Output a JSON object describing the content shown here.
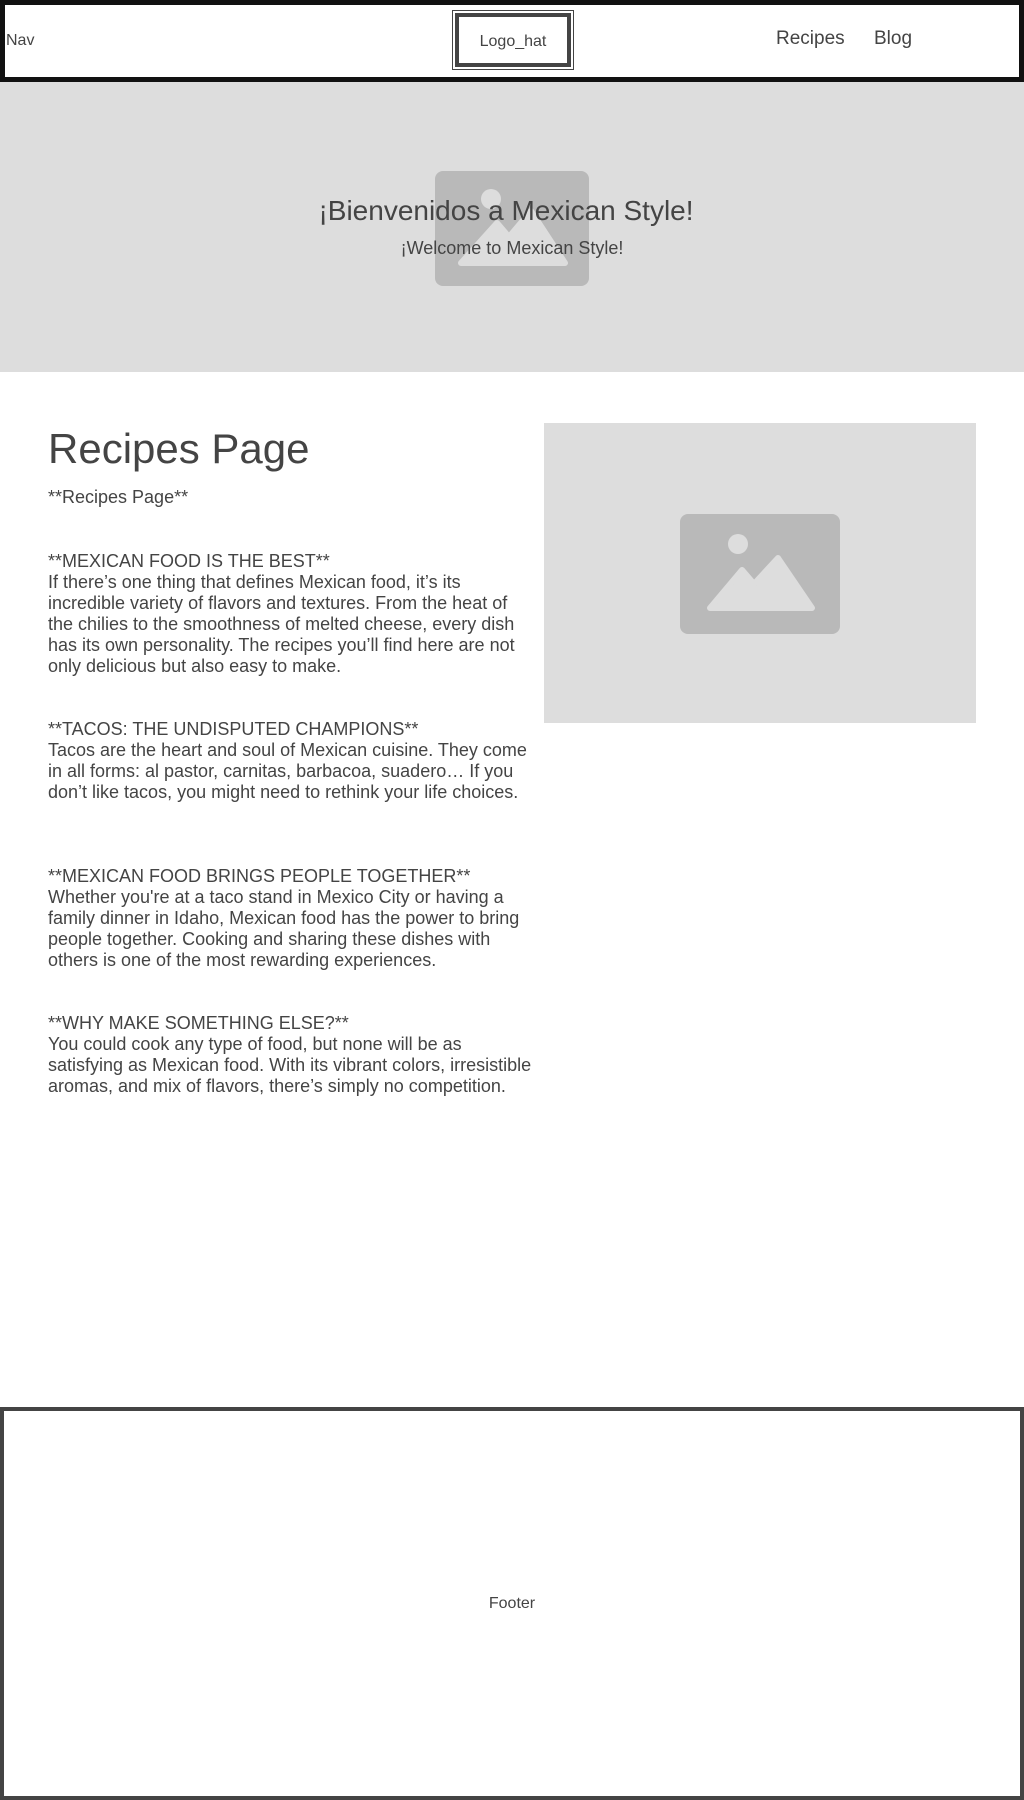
{
  "nav": {
    "label": "Nav",
    "logo": "Logo_hat",
    "links": [
      "Recipes",
      "Blog"
    ]
  },
  "hero": {
    "title": "¡Bienvenidos a Mexican Style!",
    "subtitle": "¡Welcome to Mexican Style!",
    "image_icon": "image-placeholder-icon"
  },
  "main": {
    "title": "Recipes Page",
    "subtitle": "**Recipes Page**",
    "sections": [
      {
        "heading": "**MEXICAN FOOD IS THE BEST**",
        "body": "If there’s one thing that defines Mexican food, it’s its incredible variety of flavors and textures. From the heat of the chilies to the smoothness of melted cheese, every dish has its own personality. The recipes you’ll find here are not only delicious but also easy to make."
      },
      {
        "heading": "**TACOS: THE UNDISPUTED CHAMPIONS**",
        "body": "Tacos are the heart and soul of Mexican cuisine. They come in all forms: al pastor, carnitas, barbacoa, suadero… If you don’t like tacos, you might need to rethink your life choices."
      },
      {
        "heading": "**MEXICAN FOOD BRINGS PEOPLE TOGETHER**",
        "body": "Whether you're at a taco stand in Mexico City or having a family dinner in Idaho, Mexican food has the power to bring people together. Cooking and sharing these dishes with others is one of the most rewarding experiences."
      },
      {
        "heading": "**WHY MAKE SOMETHING ELSE?**",
        "body": "You could cook any type of food, but none will be as satisfying as Mexican food. With its vibrant colors, irresistible aromas, and mix of flavors, there’s simply no competition."
      }
    ],
    "image_icon": "image-placeholder-icon"
  },
  "footer": {
    "label": "Footer"
  }
}
